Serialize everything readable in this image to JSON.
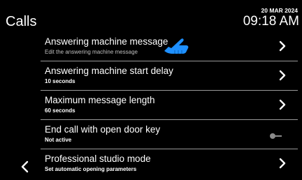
{
  "header": {
    "title": "Calls",
    "date": "20 MAR 2024",
    "time": "09:18 AM"
  },
  "settings": [
    {
      "label": "Answering machine message",
      "sub": "Edit the answering machine message",
      "sub_style": "muted",
      "control": "chevron"
    },
    {
      "label": "Answering machine start delay",
      "sub": "10 seconds",
      "sub_style": "bold",
      "control": "chevron"
    },
    {
      "label": "Maximum message length",
      "sub": "60 seconds",
      "sub_style": "bold",
      "control": "chevron"
    },
    {
      "label": "End call with open door key",
      "sub": "Not active",
      "sub_style": "bold",
      "control": "toggle",
      "toggle_on": false
    },
    {
      "label": "Professional studio mode",
      "sub": "Set automatic opening parameters",
      "sub_style": "bold",
      "control": "chevron"
    }
  ],
  "icons": {
    "back": "chevron-left-icon",
    "row_action": "chevron-right-icon",
    "toggle": "toggle-switch-icon",
    "pointer": "hand-pointer-icon"
  },
  "colors": {
    "background": "#000000",
    "text": "#ffffff",
    "divider": "#9a9a9a",
    "pointer": "#1e90ff"
  }
}
